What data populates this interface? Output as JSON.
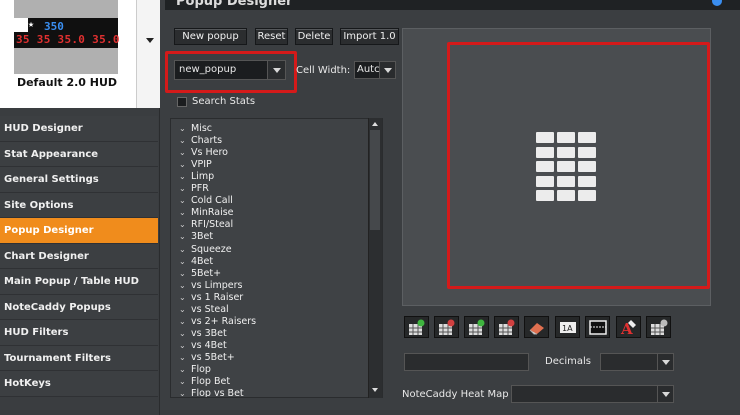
{
  "window": {
    "title": "Popup Designer"
  },
  "hud_preview": {
    "row1": "350",
    "row2": "35 35 35.0 35.0",
    "label": "Default 2.0 HUD"
  },
  "nav": {
    "items": [
      {
        "label": "HUD Designer",
        "active": false
      },
      {
        "label": "Stat Appearance",
        "active": false
      },
      {
        "label": "General Settings",
        "active": false
      },
      {
        "label": "Site Options",
        "active": false
      },
      {
        "label": "Popup Designer",
        "active": true
      },
      {
        "label": "Chart Designer",
        "active": false
      },
      {
        "label": "Main Popup / Table HUD",
        "active": false
      },
      {
        "label": "NoteCaddy Popups",
        "active": false
      },
      {
        "label": "HUD Filters",
        "active": false
      },
      {
        "label": "Tournament Filters",
        "active": false
      },
      {
        "label": "HotKeys",
        "active": false
      }
    ]
  },
  "toolbar": {
    "new_popup": "New popup",
    "reset": "Reset",
    "delete": "Delete",
    "import": "Import 1.0"
  },
  "popup_select": {
    "value": "new_popup"
  },
  "cell_width": {
    "label": "Cell Width:",
    "value": "Autc"
  },
  "search_stats": {
    "label": "Search Stats",
    "checked": false
  },
  "stats": [
    "Misc",
    "Charts",
    "Vs Hero",
    "VPIP",
    "Limp",
    "PFR",
    "Cold Call",
    "MinRaise",
    "RFI/Steal",
    "3Bet",
    "Squeeze",
    "4Bet",
    "5Bet+",
    "vs Limpers",
    "vs 1 Raiser",
    "vs Steal",
    "vs 2+ Raisers",
    "vs 3Bet",
    "vs 4Bet",
    "vs 5Bet+",
    "Flop",
    "Flop Bet",
    "Flop vs Bet"
  ],
  "tools": [
    {
      "name": "add-column-icon"
    },
    {
      "name": "remove-column-icon"
    },
    {
      "name": "add-row-icon"
    },
    {
      "name": "remove-row-icon"
    },
    {
      "name": "eraser-icon"
    },
    {
      "name": "text-label-icon",
      "text": "1A"
    },
    {
      "name": "cell-border-icon"
    },
    {
      "name": "text-format-icon"
    },
    {
      "name": "grid-settings-icon"
    }
  ],
  "decimals": {
    "label": "Decimals",
    "value": ""
  },
  "heatmap": {
    "label": "NoteCaddy Heat Map",
    "value": ""
  },
  "colors": {
    "accent": "#f08c1c",
    "highlight": "#d41a1a"
  }
}
